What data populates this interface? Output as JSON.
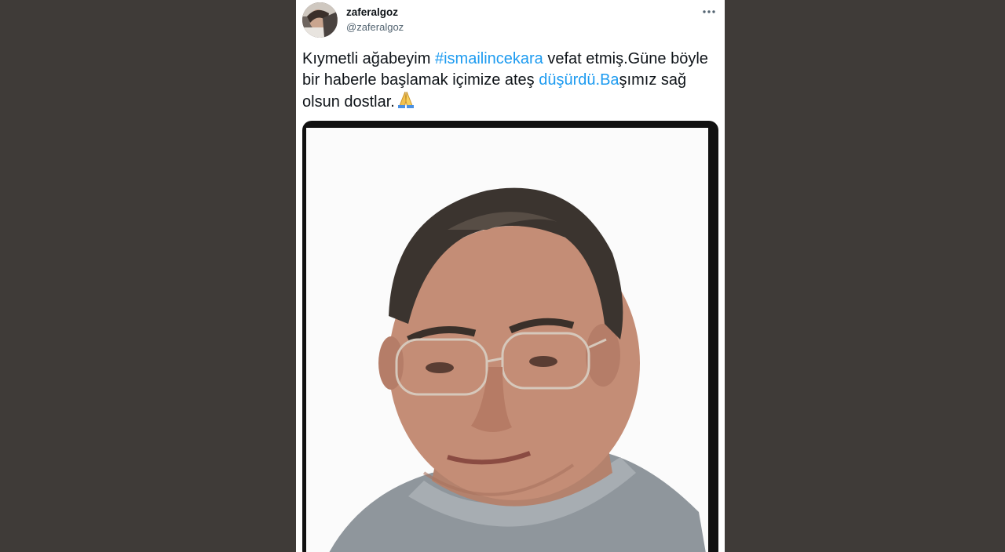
{
  "tweet": {
    "author_name": "zaferalgoz",
    "author_handle": "@zaferalgoz",
    "text_part1": "Kıymetli ağabeyim ",
    "hashtag": "#ismailincekara",
    "text_part2": " vefat etmiş.Güne böyle bir haberle başlamak içimize ateş ",
    "link_text": "düşürdü.Ba",
    "text_part3": "şımız sağ olsun dostlar.",
    "emoji": "folded-hands-emoji"
  },
  "media": {
    "kind": "portrait-photo"
  },
  "icons": {
    "more": "more-horizontal-icon"
  },
  "colors": {
    "background": "#3f3b38",
    "card": "#ffffff",
    "link": "#1d9bf0",
    "text": "#0f1419",
    "muted": "#536471"
  }
}
